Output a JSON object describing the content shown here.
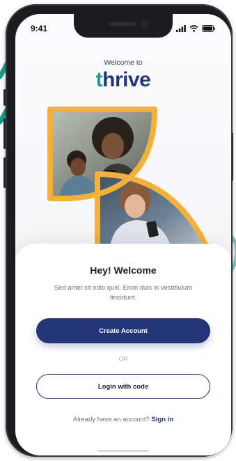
{
  "status_bar": {
    "time": "9:41"
  },
  "header": {
    "welcome_to": "Welcome to",
    "logo_mark": "t",
    "logo_rest": "hrive"
  },
  "card": {
    "title": "Hey! Welcome",
    "subtitle": "Sed amet sit odio quis. Enim duis in vestibulum tincidunt.",
    "create_account": "Create Account",
    "or": "OR",
    "login_with_code": "Login with code",
    "have_account": "Already have an account?",
    "sign_in": "Sign in"
  },
  "colors": {
    "brand_navy": "#243578",
    "brand_teal": "#1f9a8a",
    "accent_yellow": "#f3b13a"
  }
}
